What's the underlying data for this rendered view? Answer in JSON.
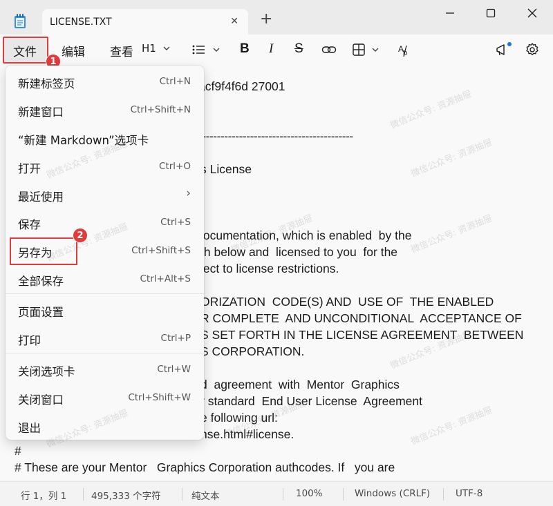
{
  "window": {
    "tab_title": "LICENSE.TXT",
    "new_tab_symbol": "+"
  },
  "menubar": {
    "file": "文件",
    "edit": "编辑",
    "view": "查看",
    "heading": "H1"
  },
  "badges": {
    "one": "1",
    "two": "2"
  },
  "file_menu": [
    {
      "label": "新建标签页",
      "shortcut": "Ctrl+N"
    },
    {
      "label": "新建窗口",
      "shortcut": "Ctrl+Shift+N"
    },
    {
      "label": "“新建 Markdown”选项卡",
      "shortcut": ""
    },
    {
      "label": "打开",
      "shortcut": "Ctrl+O"
    },
    {
      "label": "最近使用",
      "shortcut": "›"
    },
    {
      "label": "保存",
      "shortcut": "Ctrl+S"
    },
    {
      "label": "另存为",
      "shortcut": "Ctrl+Shift+S"
    },
    {
      "label": "全部保存",
      "shortcut": "Ctrl+Alt+S"
    },
    {
      "label": "页面设置",
      "shortcut": ""
    },
    {
      "label": "打印",
      "shortcut": "Ctrl+P"
    },
    {
      "label": "关闭选项卡",
      "shortcut": "Ctrl+W"
    },
    {
      "label": "关闭窗口",
      "shortcut": "Ctrl+Shift+W"
    },
    {
      "label": "退出",
      "shortcut": ""
    }
  ],
  "editor_lines": [
    "acf9f4f6d 27001",
    "------------------------------------------",
    "s License",
    "locumentation, which is enabled  by the",
    "th below and  licensed to you  for the",
    "ject to license restrictions.",
    "ORIZATION  CODE(S) AND  USE OF  THE ENABLED",
    "R COMPLETE  AND UNCONDITIONAL  ACCEPTANCE OF",
    "S SET FORTH IN THE LICENSE AGREEMENT  BETWEEN",
    "S CORPORATION.",
    "d  agreement  with  Mentor  Graphics",
    "r standard  End User License  Agreement",
    "e following url:",
    "nse.html#license.",
    "#",
    "# These are your Mentor   Graphics Corporation authcodes. If   you are"
  ],
  "watermark_text": "微信公众号: 资源抽屉",
  "status": {
    "position": "行 1，列 1",
    "char_count": "495,333 个字符",
    "format": "纯文本",
    "zoom": "100%",
    "line_ending": "Windows (CRLF)",
    "encoding": "UTF-8"
  },
  "colors": {
    "highlight_red": "#e03c3c",
    "notification_dot": "#1a73e8"
  }
}
